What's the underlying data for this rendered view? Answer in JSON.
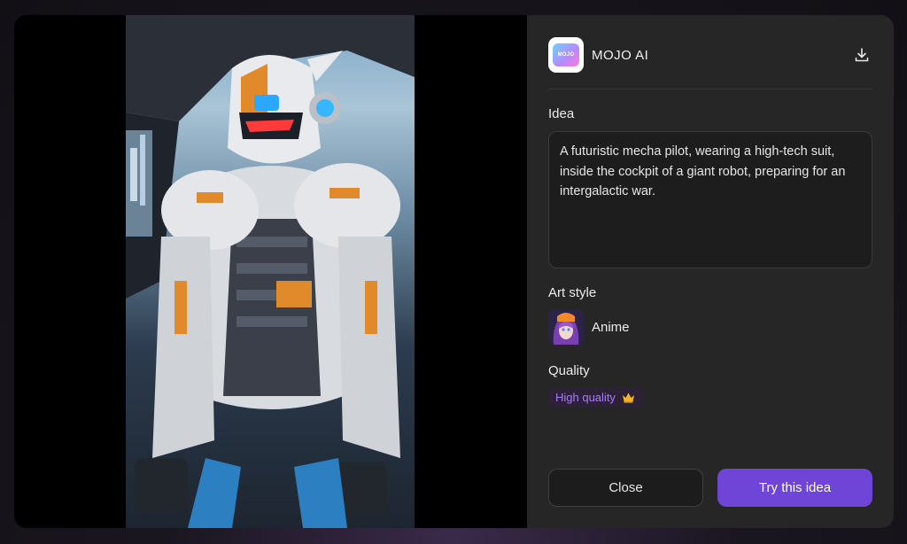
{
  "app": {
    "name": "MOJO AI",
    "logo_text": "MOJO"
  },
  "idea": {
    "label": "Idea",
    "text": "A futuristic mecha pilot, wearing a high-tech suit, inside the cockpit of a giant robot, preparing for an intergalactic war."
  },
  "art_style": {
    "label": "Art style",
    "value": "Anime"
  },
  "quality": {
    "label": "Quality",
    "value": "High quality",
    "icon": "crown-icon"
  },
  "buttons": {
    "close": "Close",
    "try": "Try this idea"
  },
  "icons": {
    "download": "download-icon"
  },
  "colors": {
    "accent": "#6e45d6",
    "quality_text": "#a77ef0",
    "panel_bg": "#262626"
  }
}
